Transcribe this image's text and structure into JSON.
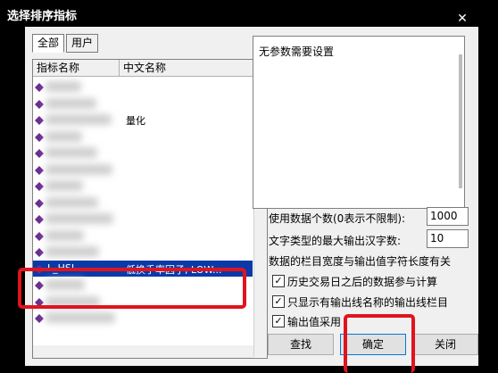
{
  "window": {
    "title": "选择排序指标",
    "close_glyph": "✕"
  },
  "tabs": [
    {
      "label": "全部",
      "active": true
    },
    {
      "label": "用户",
      "active": false
    }
  ],
  "list": {
    "columns": [
      "指标名称",
      "中文名称"
    ],
    "rows": [
      {
        "name": "",
        "cn": ""
      },
      {
        "name": "",
        "cn": ""
      },
      {
        "name": "",
        "cn": "量化"
      },
      {
        "name": "",
        "cn": ""
      },
      {
        "name": "",
        "cn": ""
      },
      {
        "name": "",
        "cn": ""
      },
      {
        "name": "",
        "cn": ""
      },
      {
        "name": "",
        "cn": ""
      },
      {
        "name": "",
        "cn": ""
      },
      {
        "name": "",
        "cn": ""
      },
      {
        "name": "",
        "cn": ""
      },
      {
        "name": "L_HSL",
        "cn": "低换手率因子, LOW...",
        "selected": true
      },
      {
        "name": "",
        "cn": ""
      },
      {
        "name": "",
        "cn": ""
      },
      {
        "name": "",
        "cn": ""
      }
    ]
  },
  "description": {
    "text": "无参数需要设置"
  },
  "settings": {
    "data_count_label": "使用数据个数(0表示不限制):",
    "data_count_value": "1000",
    "max_chars_label": "文字类型的最大输出汉字数:",
    "max_chars_value": "10",
    "note": "数据的栏目宽度与输出值字符长度有关",
    "checkboxes": [
      {
        "label": "历史交易日之后的数据参与计算",
        "checked": true
      },
      {
        "label": "只显示有输出线名称的输出线栏目",
        "checked": true
      },
      {
        "label": "输出值采用",
        "checked": true
      }
    ]
  },
  "buttons": {
    "search": "查找",
    "ok": "确定",
    "close": "关闭"
  },
  "colors": {
    "selection": "#0a3aa8",
    "highlight_red": "#e0141e",
    "icon_purple": "#6a2d8f"
  }
}
